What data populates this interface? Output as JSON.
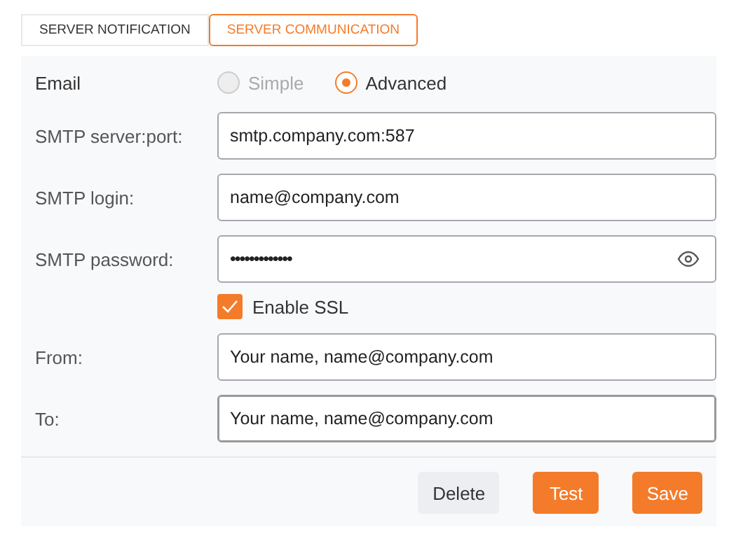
{
  "tabs": [
    {
      "label": "SERVER NOTIFICATION",
      "selected": false
    },
    {
      "label": "SERVER COMMUNICATION",
      "selected": true
    }
  ],
  "email": {
    "label": "Email",
    "options": [
      {
        "label": "Simple",
        "selected": false,
        "disabled": true
      },
      {
        "label": "Advanced",
        "selected": true,
        "disabled": false
      }
    ]
  },
  "fields": [
    {
      "kind": "text",
      "label": "SMTP server:port:",
      "value": "smtp.company.com:587"
    },
    {
      "kind": "text",
      "label": "SMTP login:",
      "value": "name@company.com"
    },
    {
      "kind": "password",
      "label": "SMTP password:",
      "value": "•••••••••••••"
    },
    {
      "kind": "checkbox",
      "label": "Enable SSL",
      "checked": true
    },
    {
      "kind": "text",
      "label": "From:",
      "value": "Your name, name@company.com"
    },
    {
      "kind": "text",
      "label": "To:",
      "value": "Your name, name@company.com",
      "focused": true
    }
  ],
  "buttons": [
    {
      "label": "Delete",
      "kind": "secondary"
    },
    {
      "label": "Test",
      "kind": "primary"
    },
    {
      "label": "Save",
      "kind": "primary"
    }
  ]
}
